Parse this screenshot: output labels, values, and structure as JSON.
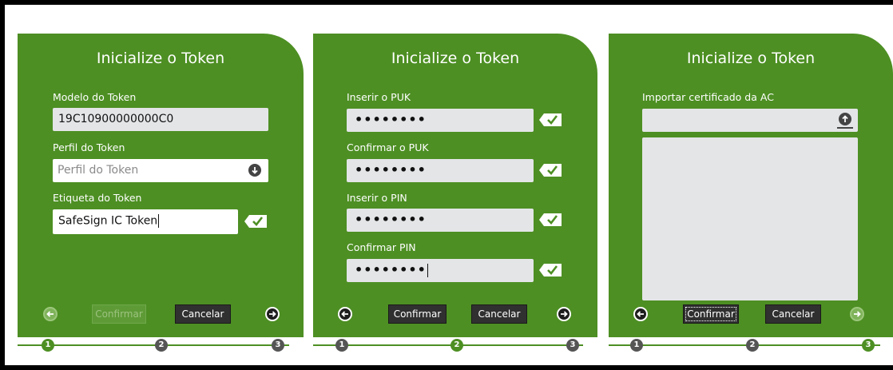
{
  "panel1": {
    "title": "Inicialize o Token",
    "model_label": "Modelo do Token",
    "model_value": "19C10900000000C0",
    "profile_label": "Perfil do Token",
    "profile_placeholder": "Perfil do Token",
    "tag_label": "Etiqueta do Token",
    "tag_value": "SafeSign IC Token",
    "confirm_label": "Confirmar",
    "cancel_label": "Cancelar",
    "steps": [
      "1",
      "2",
      "3"
    ]
  },
  "panel2": {
    "title": "Inicialize o Token",
    "puk_label": "Inserir o PUK",
    "puk_value": "••••••••",
    "puk_confirm_label": "Confirmar o PUK",
    "puk_confirm_value": "••••••••",
    "pin_label": "Inserir o PIN",
    "pin_value": "••••••••",
    "pin_confirm_label": "Confirmar PIN",
    "pin_confirm_value": "••••••••",
    "confirm_label": "Confirmar",
    "cancel_label": "Cancelar",
    "steps": [
      "1",
      "2",
      "3"
    ]
  },
  "panel3": {
    "title": "Inicialize o Token",
    "import_label": "Importar certificado da AC",
    "confirm_label": "Confirmar",
    "cancel_label": "Cancelar",
    "steps": [
      "1",
      "2",
      "3"
    ]
  },
  "colors": {
    "panel_green": "#4d8f23",
    "field_gray": "#e3e5e7",
    "button_dark": "#303030"
  }
}
